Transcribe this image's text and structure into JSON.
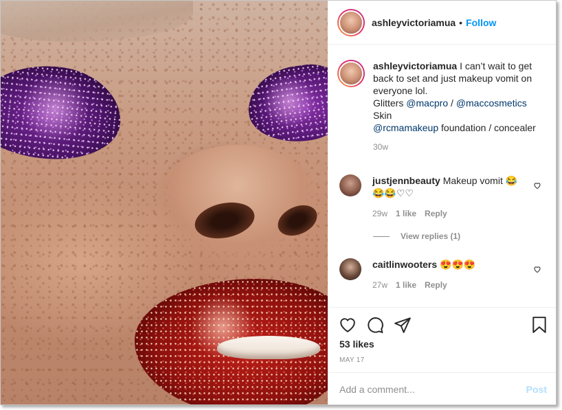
{
  "post": {
    "username": "ashleyvictoriamua",
    "dot": "•",
    "follow_label": "Follow"
  },
  "caption": {
    "username": "ashleyvictoriamua",
    "text_1": "I can’t wait to get back to set and just makeup vomit on everyone lol.",
    "line_2_prefix": "Glitters ",
    "mention_1": "@macpro",
    "sep": " / ",
    "mention_2": "@maccosmetics",
    "line_3": "Skin",
    "mention_3": "@rcmamakeup",
    "line_4_suffix": " foundation / concealer",
    "time": "30w"
  },
  "comments": [
    {
      "username": "justjennbeauty",
      "text": "Makeup vomit 😂😂😂♡♡",
      "time": "29w",
      "likes": "1 like",
      "reply": "Reply",
      "view_replies": "View replies (1)"
    },
    {
      "username": "caitlinwooters",
      "text": "😍😍😍",
      "time": "27w",
      "likes": "1 like",
      "reply": "Reply"
    }
  ],
  "actions": {
    "likes": "53 likes",
    "date": "MAY 17"
  },
  "add_comment": {
    "placeholder": "Add a comment...",
    "post_label": "Post"
  },
  "icons": [
    "heart-icon",
    "comment-icon",
    "share-icon",
    "bookmark-icon"
  ],
  "colors": {
    "link_blue": "#0095f6",
    "mention": "#00376b",
    "muted": "#8e8e8e",
    "post_disabled": "#b2dffc"
  }
}
